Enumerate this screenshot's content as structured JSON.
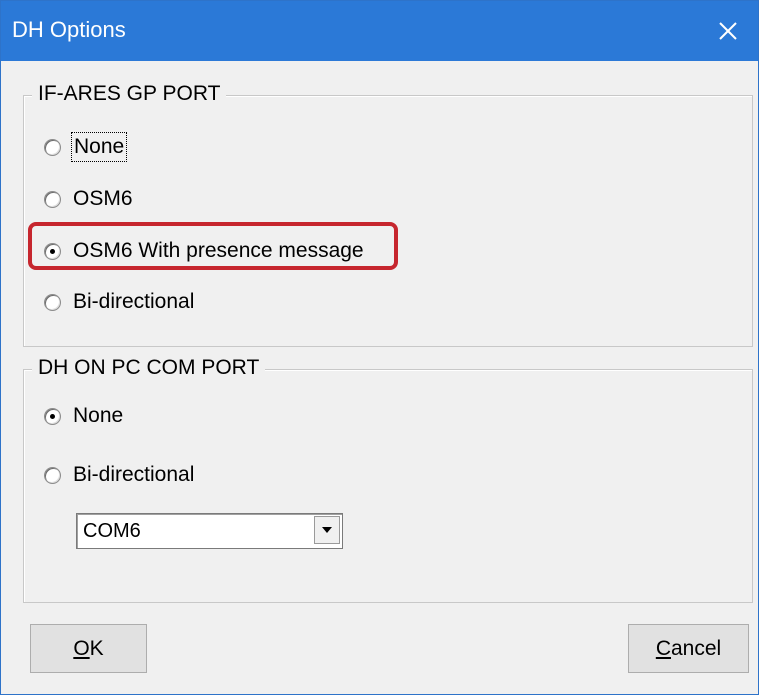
{
  "window": {
    "title": "DH Options",
    "close_icon": "close-icon"
  },
  "if_ares_group": {
    "legend": "IF-ARES GP PORT",
    "options": [
      {
        "label": "None",
        "checked": false,
        "focused": true
      },
      {
        "label": "OSM6",
        "checked": false
      },
      {
        "label": "OSM6 With presence message",
        "checked": true,
        "highlighted": true
      },
      {
        "label": "Bi-directional",
        "checked": false
      }
    ]
  },
  "dh_pc_group": {
    "legend": "DH ON PC COM PORT",
    "options": [
      {
        "label": "None",
        "checked": true
      },
      {
        "label": "Bi-directional",
        "checked": false
      }
    ],
    "com_select": {
      "value": "COM6",
      "arrow_icon": "chevron-down-icon"
    }
  },
  "buttons": {
    "ok_mnemonic": "O",
    "ok_rest": "K",
    "cancel_mnemonic": "C",
    "cancel_rest": "ancel"
  },
  "colors": {
    "title_bar": "#2b79d7",
    "highlight": "#c6262e",
    "dialog_bg": "#f0f0f0"
  }
}
